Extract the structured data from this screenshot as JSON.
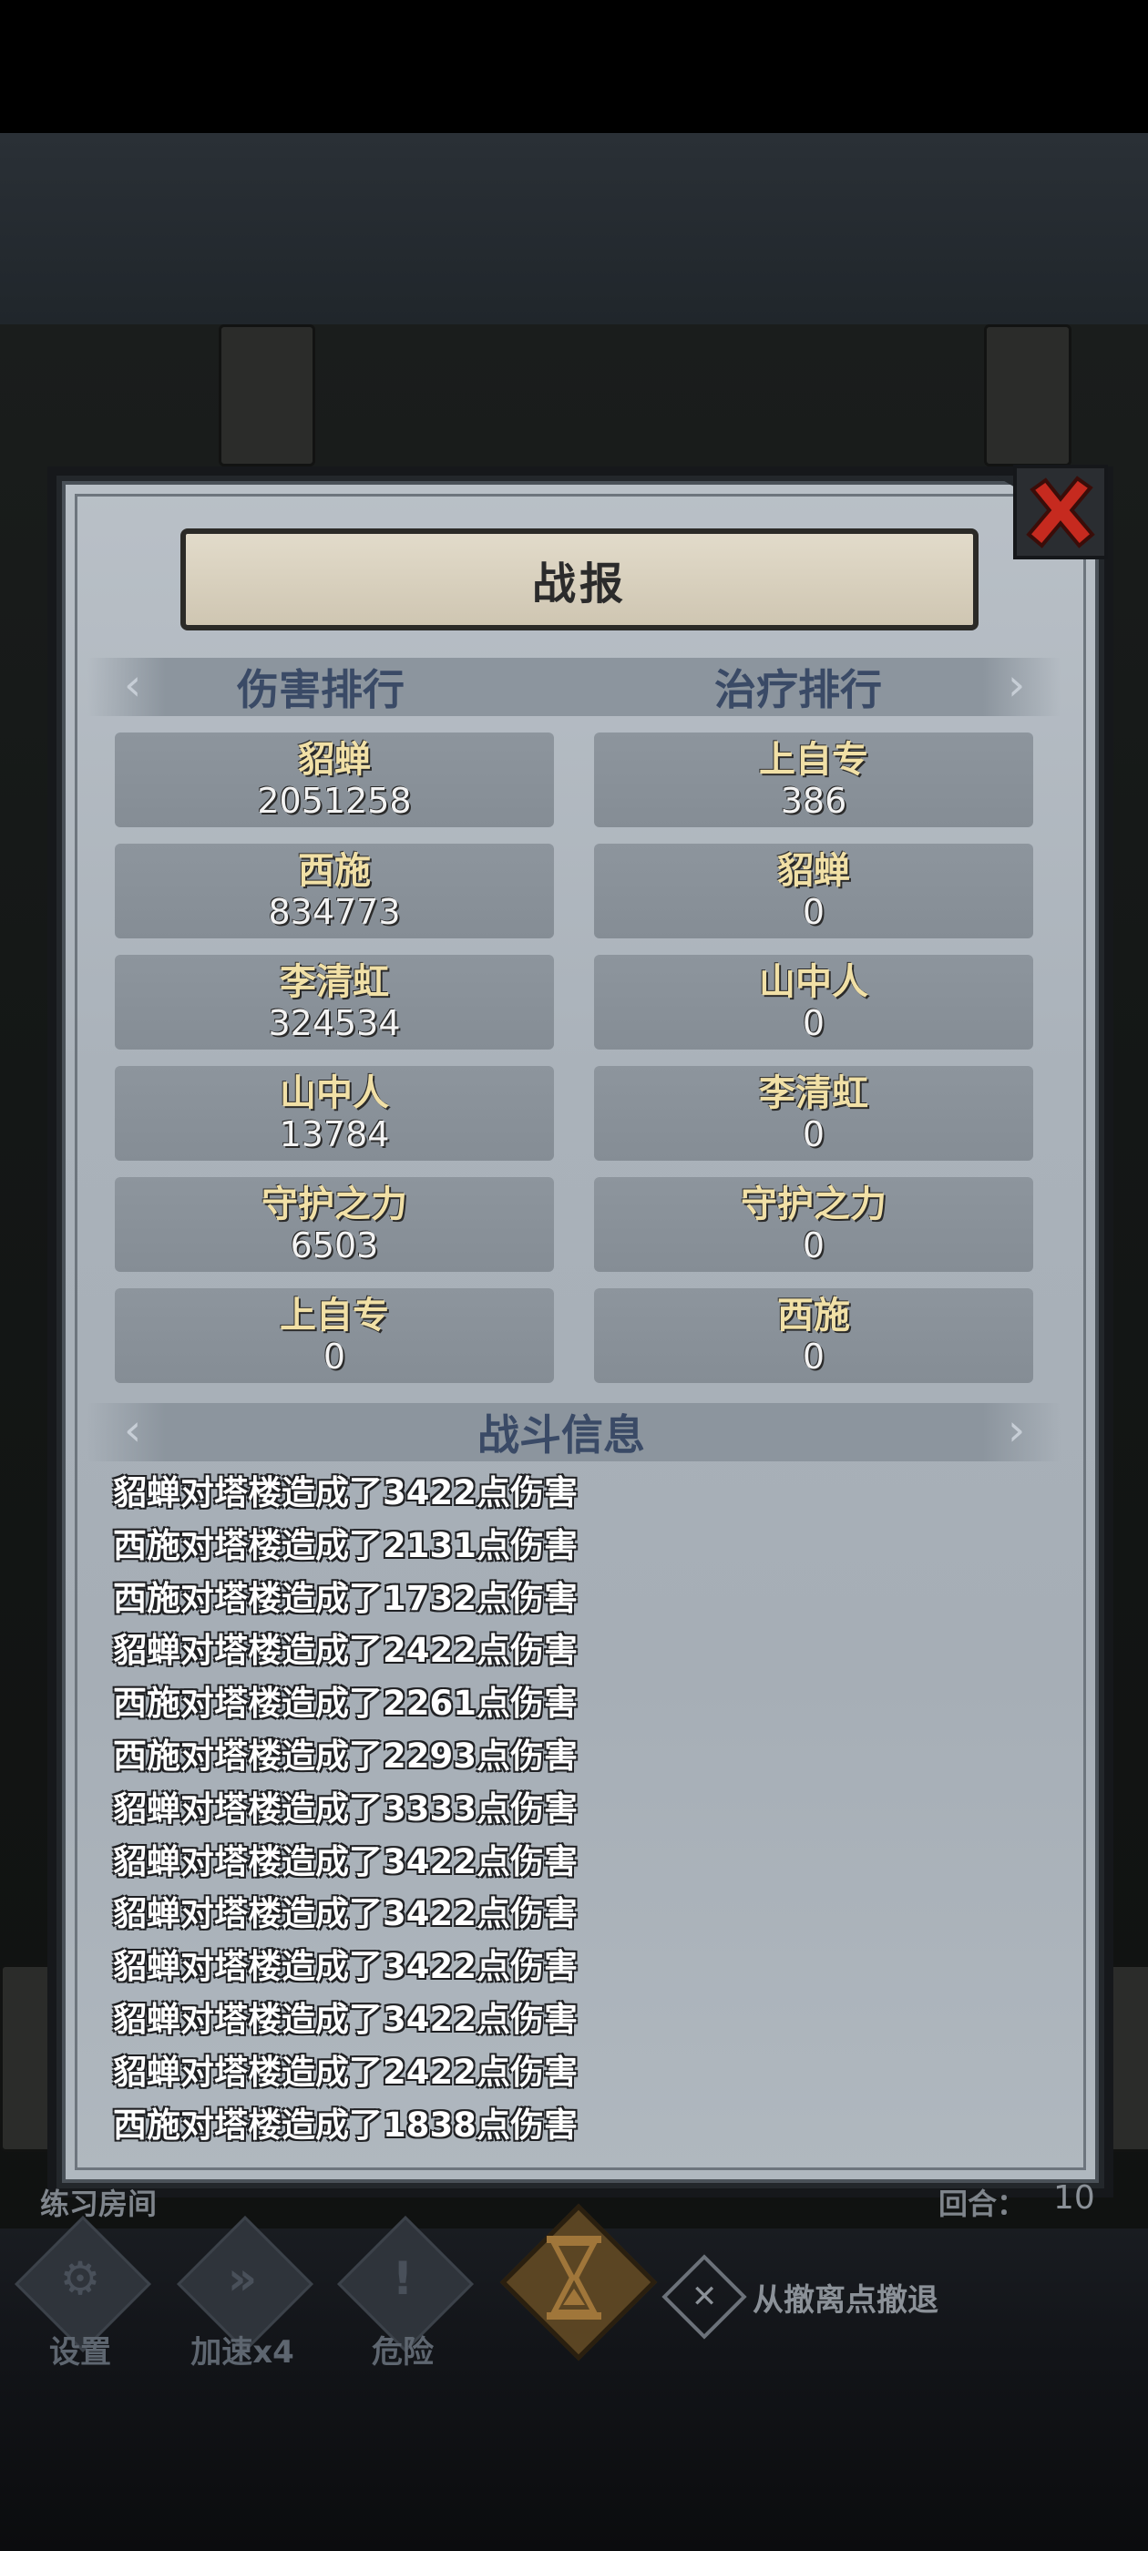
{
  "dialog": {
    "title": "战报",
    "close_icon": "close-x-icon",
    "damage_header": "伤害排行",
    "heal_header": "治疗排行",
    "info_header": "战斗信息"
  },
  "damage_ranking": [
    {
      "name": "貂蝉",
      "value": "2051258"
    },
    {
      "name": "西施",
      "value": "834773"
    },
    {
      "name": "李清虹",
      "value": "324534"
    },
    {
      "name": "山中人",
      "value": "13784"
    },
    {
      "name": "守护之力",
      "value": "6503"
    },
    {
      "name": "上自专",
      "value": "0"
    }
  ],
  "heal_ranking": [
    {
      "name": "上自专",
      "value": "386"
    },
    {
      "name": "貂蝉",
      "value": "0"
    },
    {
      "name": "山中人",
      "value": "0"
    },
    {
      "name": "李清虹",
      "value": "0"
    },
    {
      "name": "守护之力",
      "value": "0"
    },
    {
      "name": "西施",
      "value": "0"
    }
  ],
  "battle_log": [
    "貂蝉对塔楼造成了3422点伤害",
    "西施对塔楼造成了2131点伤害",
    "西施对塔楼造成了1732点伤害",
    "貂蝉对塔楼造成了2422点伤害",
    "西施对塔楼造成了2261点伤害",
    "西施对塔楼造成了2293点伤害",
    "貂蝉对塔楼造成了3333点伤害",
    "貂蝉对塔楼造成了3422点伤害",
    "貂蝉对塔楼造成了3422点伤害",
    "貂蝉对塔楼造成了3422点伤害",
    "貂蝉对塔楼造成了3422点伤害",
    "貂蝉对塔楼造成了2422点伤害",
    "西施对塔楼造成了1838点伤害"
  ],
  "status": {
    "room_name": "练习房间",
    "round_label": "回合：",
    "round_value": "10"
  },
  "toolbar": {
    "settings_label": "设置",
    "speed_label": "加速x4",
    "danger_label": "危险",
    "speed_glyph": "»",
    "danger_glyph": "!",
    "settings_glyph": "⚙",
    "retreat_label": "从撤离点撤退",
    "retreat_glyph": "✕"
  },
  "colors": {
    "name_gold": "#f1e0a6",
    "header_blue": "#3a4a66",
    "close_red": "#c62a1f",
    "panel_gray": "#aab2ba"
  }
}
